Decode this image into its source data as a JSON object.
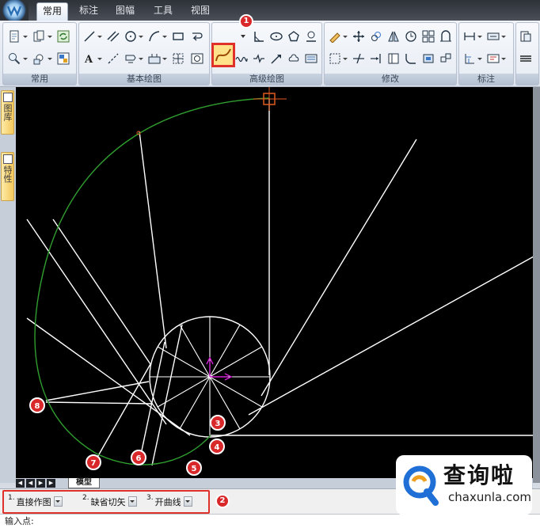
{
  "window": {
    "tabs": [
      {
        "label": "常用",
        "active": true
      },
      {
        "label": "标注",
        "active": false
      },
      {
        "label": "图幅",
        "active": false
      },
      {
        "label": "工具",
        "active": false
      },
      {
        "label": "视图",
        "active": false
      }
    ]
  },
  "ribbon": {
    "panels": [
      {
        "title": "常用"
      },
      {
        "title": "基本绘图"
      },
      {
        "title": "高级绘图"
      },
      {
        "title": "修改"
      },
      {
        "title": "标注"
      }
    ],
    "highlighted_tool": "spline-tool"
  },
  "left_dock": {
    "tabs": [
      {
        "label": "图库"
      },
      {
        "label": "特性"
      }
    ]
  },
  "drawing": {
    "background": "#000000",
    "line_color": "#ffffff",
    "curve_color": "#2f9e2f",
    "cursor_color": "#e05a1e",
    "ucs_color": "#d020d0"
  },
  "annotations": {
    "markers": [
      "1",
      "2",
      "3",
      "4",
      "5",
      "6",
      "7",
      "8"
    ],
    "marker_color": "#d8282a",
    "frame_color": "#e0302a"
  },
  "layout": {
    "nav_arrows": [
      "◀",
      "◀",
      "▶",
      "▶"
    ],
    "model_tab": "模型"
  },
  "options": [
    {
      "num": "1.",
      "value": "直接作图"
    },
    {
      "num": "2.",
      "value": "缺省切矢"
    },
    {
      "num": "3.",
      "value": "开曲线"
    }
  ],
  "command": {
    "prompt": "输入点:"
  },
  "watermark": {
    "name": "查询啦",
    "domain": "chaxunla.com",
    "color": "#1f6fd6"
  }
}
